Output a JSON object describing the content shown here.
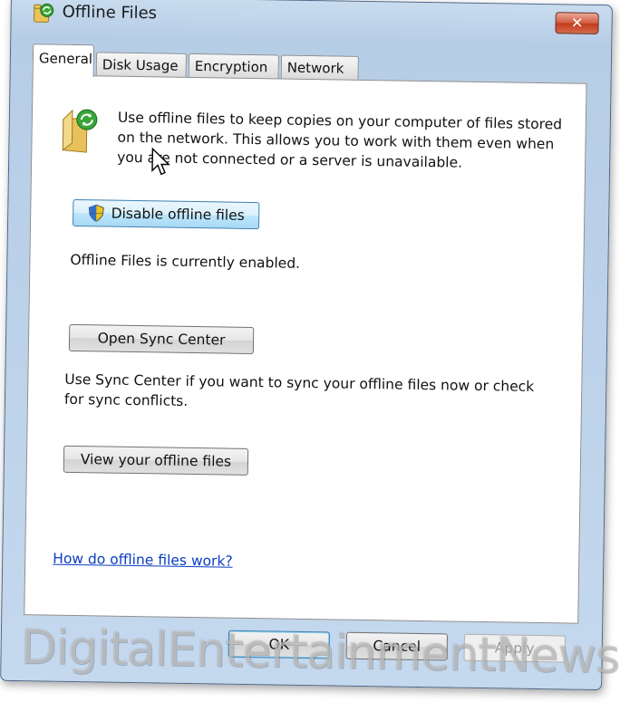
{
  "window": {
    "title": "Offline Files",
    "close_label": "✕"
  },
  "tabs": [
    {
      "label": "General"
    },
    {
      "label": "Disk Usage"
    },
    {
      "label": "Encryption"
    },
    {
      "label": "Network"
    }
  ],
  "general": {
    "description": "Use offline files to keep copies on your computer of files stored on the network.  This allows you to work with them even when you are not connected or a server is unavailable.",
    "disable_button": "Disable offline files",
    "status_text": "Offline Files is currently enabled.",
    "sync_center_button": "Open Sync Center",
    "sync_center_text": "Use Sync Center if you want to sync your offline files now or check for sync conflicts.",
    "view_files_button": "View your offline files",
    "help_link": "How do offline files work?"
  },
  "footer": {
    "ok": "OK",
    "cancel": "Cancel",
    "apply": "Apply"
  },
  "watermark": "DigitalEntertainmentNews.com",
  "icons": [
    "offline-files-app-icon",
    "folder-sync-icon",
    "uac-shield-icon",
    "mouse-cursor-icon"
  ]
}
